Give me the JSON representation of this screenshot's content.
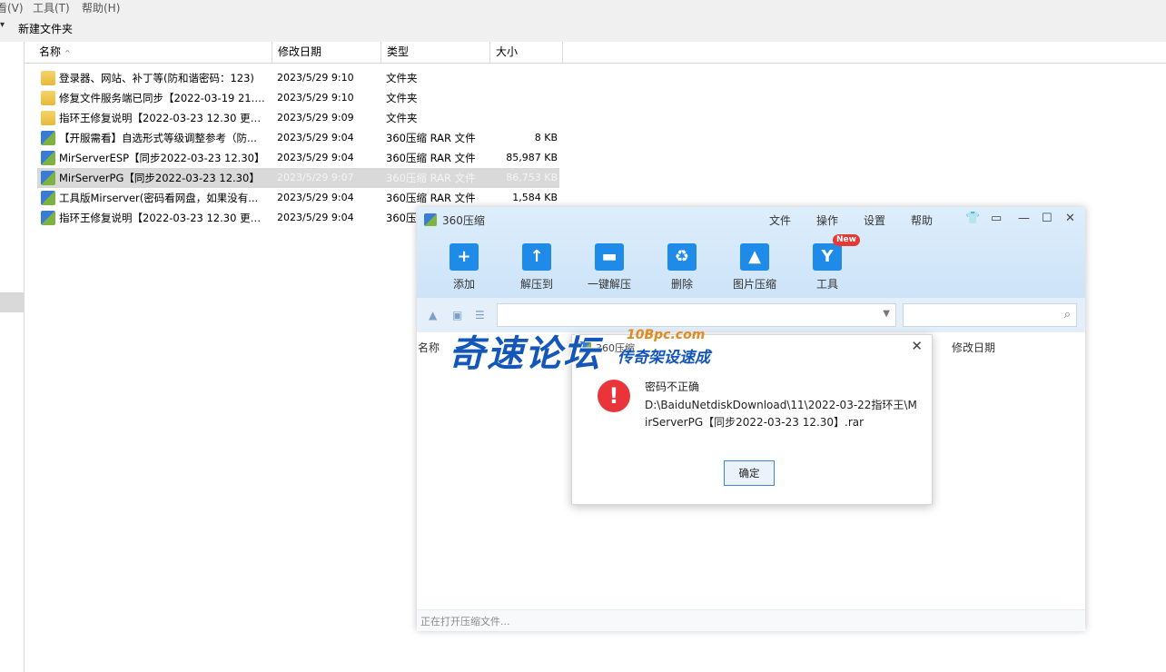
{
  "explorer": {
    "menu": [
      "看(V)",
      "工具(T)",
      "帮助(H)"
    ],
    "toolbar": {
      "new_folder": "新建文件夹"
    },
    "columns": {
      "name": "名称",
      "date": "修改日期",
      "type": "类型",
      "size": "大小"
    },
    "rows": [
      {
        "icon": "folder-icon",
        "name": "登录器、网站、补丁等(防和谐密码：123)",
        "date": "2023/5/29 9:10",
        "type": "文件夹",
        "size": ""
      },
      {
        "icon": "folder-icon",
        "name": "修复文件服务端已同步【2022-03-19 21.3...",
        "date": "2023/5/29 9:10",
        "type": "文件夹",
        "size": ""
      },
      {
        "icon": "folder-icon",
        "name": "指环王修复说明【2022-03-23 12.30 更】(...",
        "date": "2023/5/29 9:09",
        "type": "文件夹",
        "size": ""
      },
      {
        "icon": "rar-icon",
        "name": "【开服需看】自选形式等级调整参考（防...",
        "date": "2023/5/29 9:04",
        "type": "360压缩 RAR 文件",
        "size": "8 KB"
      },
      {
        "icon": "rar-icon",
        "name": "MirServerESP【同步2022-03-23 12.30】",
        "date": "2023/5/29 9:04",
        "type": "360压缩 RAR 文件",
        "size": "85,987 KB"
      },
      {
        "icon": "rar-icon",
        "name": "MirServerPG【同步2022-03-23 12.30】",
        "date": "2023/5/29 9:07",
        "type": "360压缩 RAR 文件",
        "size": "86,753 KB"
      },
      {
        "icon": "rar-icon",
        "name": "工具版Mirserver(密码看网盘，如果没有...",
        "date": "2023/5/29 9:04",
        "type": "360压缩 RAR 文件",
        "size": "1,584 KB"
      },
      {
        "icon": "rar-icon",
        "name": "指环王修复说明【2022-03-23 12.30 更】(...",
        "date": "2023/5/29 9:04",
        "type": "360压",
        "size": ""
      }
    ]
  },
  "zip": {
    "title": "360压缩",
    "menus": [
      "文件",
      "操作",
      "设置",
      "帮助"
    ],
    "tools": [
      {
        "label": "添加",
        "icon": "add-icon",
        "glyph": "+"
      },
      {
        "label": "解压到",
        "icon": "extract-to-icon",
        "glyph": "↑"
      },
      {
        "label": "一键解压",
        "icon": "one-click-extract-icon",
        "glyph": "▬"
      },
      {
        "label": "删除",
        "icon": "delete-icon",
        "glyph": "♻"
      },
      {
        "label": "图片压缩",
        "icon": "image-compress-icon",
        "glyph": "▲"
      },
      {
        "label": "工具",
        "icon": "tools-icon",
        "glyph": "Y"
      }
    ],
    "new_badge": "New",
    "list_header": {
      "name": "名称",
      "date": "修改日期"
    },
    "status": "正在打开压缩文件..."
  },
  "dialog": {
    "title": "360压缩",
    "message_title": "密码不正确",
    "message_path": "D:\\BaiduNetdiskDownload\\11\\2022-03-22指环王\\MirServerPG【同步2022-03-23 12.30】.rar",
    "ok": "确定"
  },
  "watermark": {
    "big": "奇速论坛",
    "url": "10Bpc.com",
    "sub": "传奇架设速成"
  },
  "colors": {
    "accent": "#1f8be8",
    "error": "#e9353a",
    "watermark_blue": "#1457b8",
    "watermark_orange": "#e08a1f"
  }
}
